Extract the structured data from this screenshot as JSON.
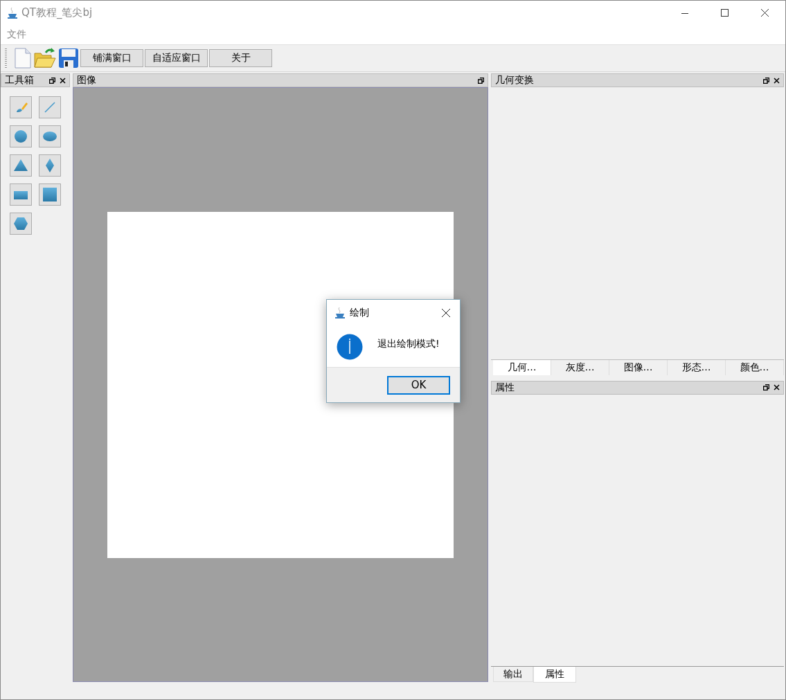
{
  "window": {
    "title": "QT教程_笔尖bj"
  },
  "menu": [
    "文件"
  ],
  "toolbar": {
    "buttons": [
      "铺满窗口",
      "自适应窗口",
      "关于"
    ]
  },
  "toolbox": {
    "title": "工具箱"
  },
  "image_dock": {
    "title": "图像"
  },
  "geometry_dock": {
    "title": "几何变换"
  },
  "right_tabs": [
    {
      "label": "几何…",
      "selected": true
    },
    {
      "label": "灰度…",
      "selected": false
    },
    {
      "label": "图像…",
      "selected": false
    },
    {
      "label": "形态…",
      "selected": false
    },
    {
      "label": "颜色…",
      "selected": false
    }
  ],
  "properties_dock": {
    "title": "属性"
  },
  "bottom_tabs": [
    {
      "label": "输出",
      "selected": false
    },
    {
      "label": "属性",
      "selected": true
    }
  ],
  "dialog": {
    "title": "绘制",
    "message": "退出绘制模式!",
    "button": "OK"
  }
}
